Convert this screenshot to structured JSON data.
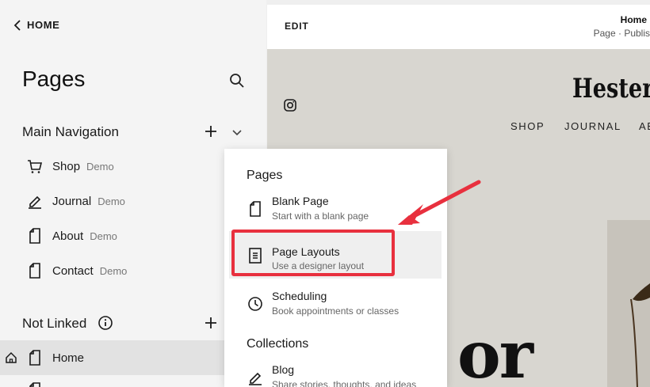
{
  "sidebar": {
    "back_label": "HOME",
    "title": "Pages",
    "main_nav_label": "Main Navigation",
    "items": [
      {
        "label": "Shop",
        "tag": "Demo",
        "icon": "cart-icon"
      },
      {
        "label": "Journal",
        "tag": "Demo",
        "icon": "blog-icon"
      },
      {
        "label": "About",
        "tag": "Demo",
        "icon": "page-icon"
      },
      {
        "label": "Contact",
        "tag": "Demo",
        "icon": "page-icon"
      }
    ],
    "not_linked_label": "Not Linked",
    "not_linked_items": [
      {
        "label": "Home",
        "icon": "page-icon"
      }
    ]
  },
  "preview": {
    "edit_label": "EDIT",
    "page_name": "Home",
    "page_status": "Page · Publis",
    "site_title": "Hester S",
    "nav": [
      "SHOP",
      "JOURNAL",
      "AE"
    ],
    "hero_text": "or"
  },
  "menu": {
    "pages_heading": "Pages",
    "items": [
      {
        "title": "Blank Page",
        "desc": "Start with a blank page",
        "icon": "page-icon"
      },
      {
        "title": "Page Layouts",
        "desc": "Use a designer layout",
        "icon": "layout-icon"
      },
      {
        "title": "Scheduling",
        "desc": "Book appointments or classes",
        "icon": "clock-icon"
      }
    ],
    "collections_heading": "Collections",
    "collections": [
      {
        "title": "Blog",
        "desc": "Share stories, thoughts, and ideas",
        "icon": "blog-icon"
      }
    ]
  },
  "colors": {
    "callout": "#e8303e",
    "sidebar_bg": "#f4f4f4",
    "preview_bg": "#d8d6d0"
  }
}
